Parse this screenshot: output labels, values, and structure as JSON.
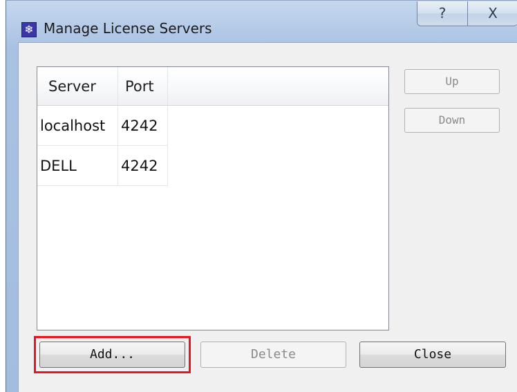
{
  "window": {
    "title": "Manage License Servers",
    "help_glyph": "?",
    "close_glyph": "X",
    "icon_glyph": "❄"
  },
  "table": {
    "columns": [
      "Server",
      "Port"
    ],
    "rows": [
      {
        "server": "localhost",
        "port": "4242"
      },
      {
        "server": "DELL",
        "port": "4242"
      }
    ]
  },
  "buttons": {
    "up": "Up",
    "down": "Down",
    "add": "Add...",
    "delete": "Delete",
    "close": "Close"
  },
  "colors": {
    "highlight": "#e8141e"
  }
}
